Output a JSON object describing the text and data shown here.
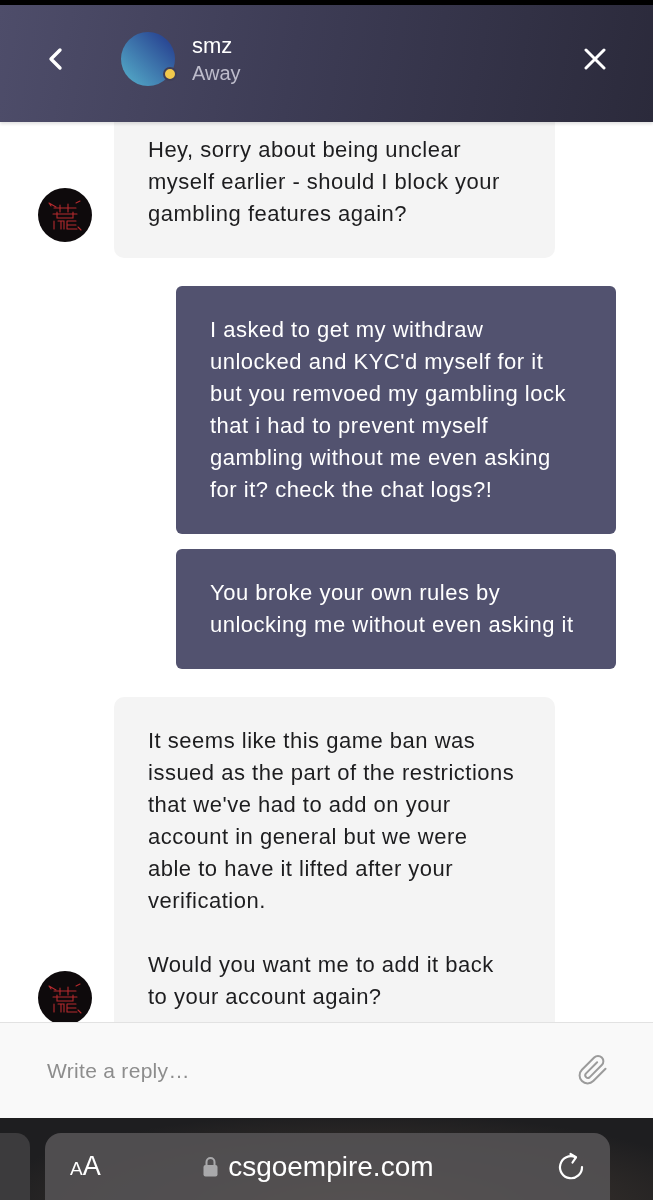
{
  "header": {
    "contact": {
      "name": "smz",
      "status": "Away",
      "color": "#f2c94c"
    }
  },
  "messages": [
    {
      "kind": "agent",
      "paragraphs": [
        "Hey, sorry about being unclear myself earlier - should I block your gambling features again?"
      ]
    },
    {
      "kind": "user",
      "paragraphs": [
        "I asked to get my withdraw unlocked and KYC'd myself for it but you remvoed my gambling lock that i had to prevent myself gambling without me even asking for it? check the chat logs?!"
      ]
    },
    {
      "kind": "user",
      "paragraphs": [
        "You broke your own rules by unlocking me without even asking it"
      ]
    },
    {
      "kind": "agent",
      "paragraphs": [
        "It seems like this game ban was issued as the part of the restrictions that we've had to add on your account in general but we were able to have it lifted after your verification.",
        "Would you want me to add it back to your account again?"
      ]
    }
  ],
  "composer": {
    "placeholder": "Write a reply…"
  },
  "browser_bar": {
    "text_size_button": "AA",
    "url": "csgoempire.com"
  }
}
